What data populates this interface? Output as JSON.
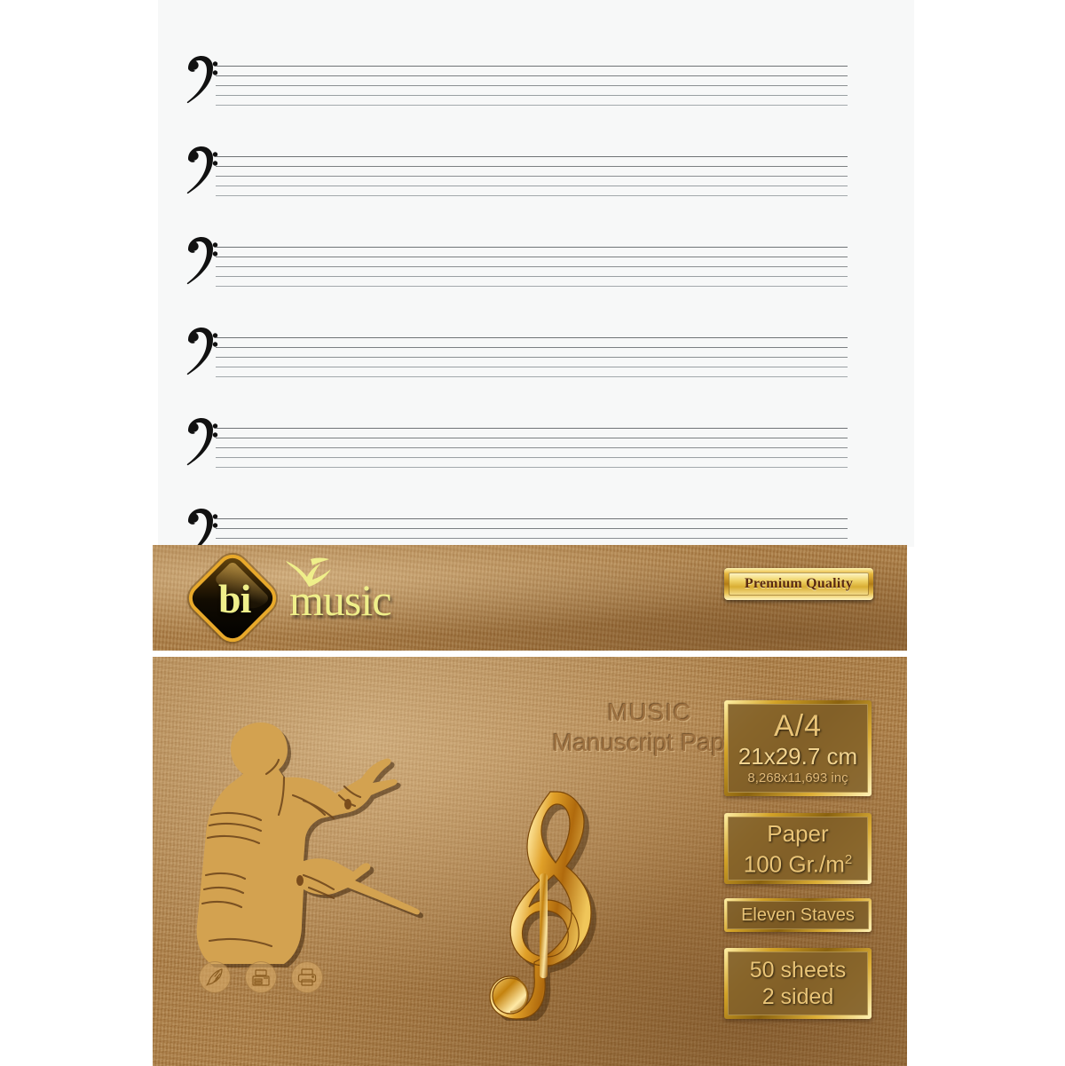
{
  "page": {
    "background_color": "#ffffff",
    "sheet_color": "#f7f8f8",
    "kraft_color": "#a87940",
    "gold_color": "#e9c477"
  },
  "staff_sheet": {
    "name": "music-manuscript-staves",
    "clef": "bass-clef",
    "staff_count": 6,
    "lines_per_staff": 5,
    "staves": [
      {
        "index": 1,
        "clef": "bass-clef"
      },
      {
        "index": 2,
        "clef": "bass-clef"
      },
      {
        "index": 3,
        "clef": "bass-clef"
      },
      {
        "index": 4,
        "clef": "bass-clef"
      },
      {
        "index": 5,
        "clef": "bass-clef"
      },
      {
        "index": 6,
        "clef": "bass-clef"
      }
    ]
  },
  "brand_band": {
    "logo_mark": "bi",
    "logo_word": "music",
    "bird_icon": "bird-icon",
    "premium_badge": "Premium Quality"
  },
  "cover": {
    "title_line1": "MUSIC",
    "title_line2": "Manuscript Paper",
    "conductor_illustration": "conductor-silhouette",
    "treble_clef": "treble-clef",
    "icons": [
      {
        "name": "quill-pen-icon",
        "label": "quill"
      },
      {
        "name": "copier-icon",
        "label": "copier"
      },
      {
        "name": "printer-icon",
        "label": "printer"
      }
    ],
    "specs": {
      "size": {
        "format": "A/4",
        "metric": "21x29.7 cm",
        "imperial": "8,268x11,693 inç"
      },
      "paper": {
        "label": "Paper",
        "weight": "100 Gr./m",
        "weight_exponent": "2"
      },
      "staves": "Eleven Staves",
      "sheets": {
        "count": "50 sheets",
        "sides": "2 sided"
      }
    }
  }
}
